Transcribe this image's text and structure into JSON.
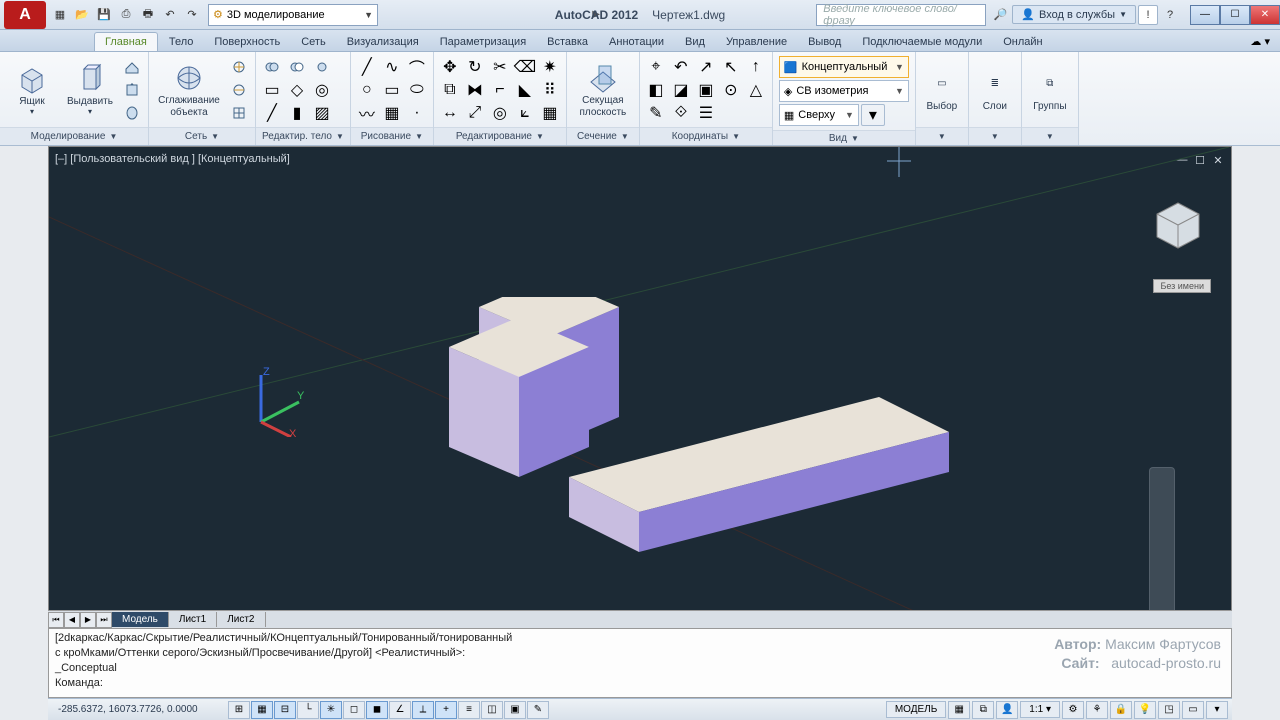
{
  "title": {
    "app": "AutoCAD 2012",
    "doc": "Чертеж1.dwg"
  },
  "search_placeholder": "Введите ключевое слово/фразу",
  "signin": "Вход в службы",
  "workspace": "3D моделирование",
  "tabs": [
    "Главная",
    "Тело",
    "Поверхность",
    "Сеть",
    "Визуализация",
    "Параметризация",
    "Вставка",
    "Аннотации",
    "Вид",
    "Управление",
    "Вывод",
    "Подключаемые модули",
    "Онлайн"
  ],
  "ribbon": {
    "modeling": {
      "title": "Моделирование",
      "box": "Ящик",
      "extrude": "Выдавить"
    },
    "mesh": {
      "title": "Сеть",
      "smooth_l1": "Сглаживание",
      "smooth_l2": "объекта"
    },
    "solidedit": {
      "title": "Редактир. тело"
    },
    "draw": {
      "title": "Рисование"
    },
    "modify": {
      "title": "Редактирование"
    },
    "section": {
      "title": "Сечение",
      "plane_l1": "Секущая",
      "plane_l2": "плоскость"
    },
    "coords": {
      "title": "Координаты"
    },
    "view": {
      "title": "Вид",
      "visual_style": "Концептуальный",
      "view_preset": "СВ изометрия",
      "view_top": "Сверху"
    },
    "select": {
      "label": "Выбор"
    },
    "layers": {
      "label": "Слои"
    },
    "groups": {
      "label": "Группы"
    }
  },
  "viewport_label": "[–] [Пользовательский вид ] [Концептуальный]",
  "viewcube_label": "Без имени",
  "model_tabs": {
    "model": "Модель",
    "sheet1": "Лист1",
    "sheet2": "Лист2"
  },
  "cmd": {
    "l1": "[2dкаркас/Каркас/Скрытие/Реалистичный/КОнцептуальный/Тонированный/тонированный",
    "l2": "с кроМками/Оттенки серого/Эскизный/Просвечивание/Другой] <Реалистичный>:",
    "l3": "_Conceptual",
    "prompt": "Команда:"
  },
  "watermark": {
    "author_lbl": "Автор:",
    "author": "Максим Фартусов",
    "site_lbl": "Сайт:",
    "site": "autocad-prosto.ru"
  },
  "status": {
    "coords": "-285.6372, 16073.7726, 0.0000",
    "space": "МОДЕЛЬ",
    "scale": "1:1"
  }
}
